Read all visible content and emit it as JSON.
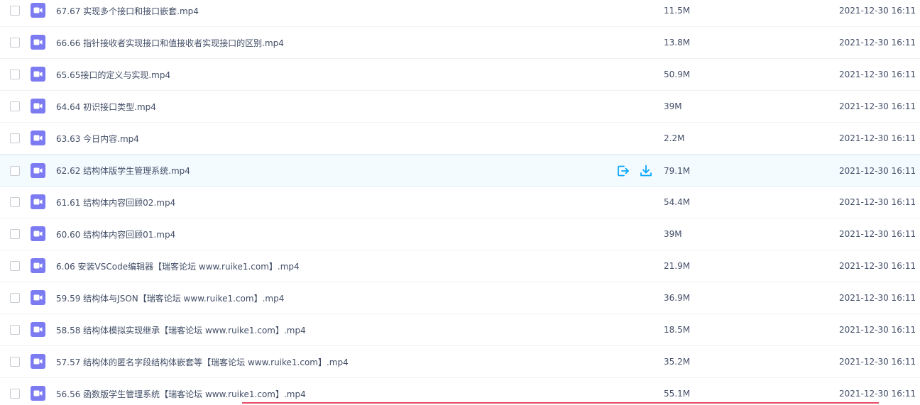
{
  "files": [
    {
      "name": "67.67 实现多个接口和接口嵌套.mp4",
      "size": "11.5M",
      "date": "2021-12-30 16:11"
    },
    {
      "name": "66.66 指针接收者实现接口和值接收者实现接口的区别.mp4",
      "size": "13.8M",
      "date": "2021-12-30 16:11"
    },
    {
      "name": "65.65接口的定义与实现.mp4",
      "size": "50.9M",
      "date": "2021-12-30 16:11"
    },
    {
      "name": "64.64 初识接口类型.mp4",
      "size": "39M",
      "date": "2021-12-30 16:11"
    },
    {
      "name": "63.63 今日内容.mp4",
      "size": "2.2M",
      "date": "2021-12-30 16:11"
    },
    {
      "name": "62.62 结构体版学生管理系统.mp4",
      "size": "79.1M",
      "date": "2021-12-30 16:11",
      "hovered": true
    },
    {
      "name": "61.61 结构体内容回顾02.mp4",
      "size": "54.4M",
      "date": "2021-12-30 16:11"
    },
    {
      "name": "60.60 结构体内容回顾01.mp4",
      "size": "39M",
      "date": "2021-12-30 16:11"
    },
    {
      "name": "6.06 安装VSCode编辑器【瑞客论坛 www.ruike1.com】.mp4",
      "size": "21.9M",
      "date": "2021-12-30 16:11"
    },
    {
      "name": "59.59 结构体与JSON【瑞客论坛 www.ruike1.com】.mp4",
      "size": "36.9M",
      "date": "2021-12-30 16:11"
    },
    {
      "name": "58.58 结构体模拟实现继承【瑞客论坛 www.ruike1.com】.mp4",
      "size": "18.5M",
      "date": "2021-12-30 16:11"
    },
    {
      "name": "57.57 结构体的匿名字段结构体嵌套等【瑞客论坛 www.ruike1.com】.mp4",
      "size": "35.2M",
      "date": "2021-12-30 16:11"
    },
    {
      "name": "56.56 函数版学生管理系统【瑞客论坛 www.ruike1.com】.mp4",
      "size": "55.1M",
      "date": "2021-12-30 16:11"
    }
  ],
  "icons": {
    "file": "video-file-icon",
    "share": "share-icon",
    "download": "download-icon"
  },
  "colors": {
    "video_icon": "#7c7bf2",
    "action_icon": "#06a7ff",
    "hover_bg": "#f4fbff",
    "underline": "#e64b62"
  }
}
